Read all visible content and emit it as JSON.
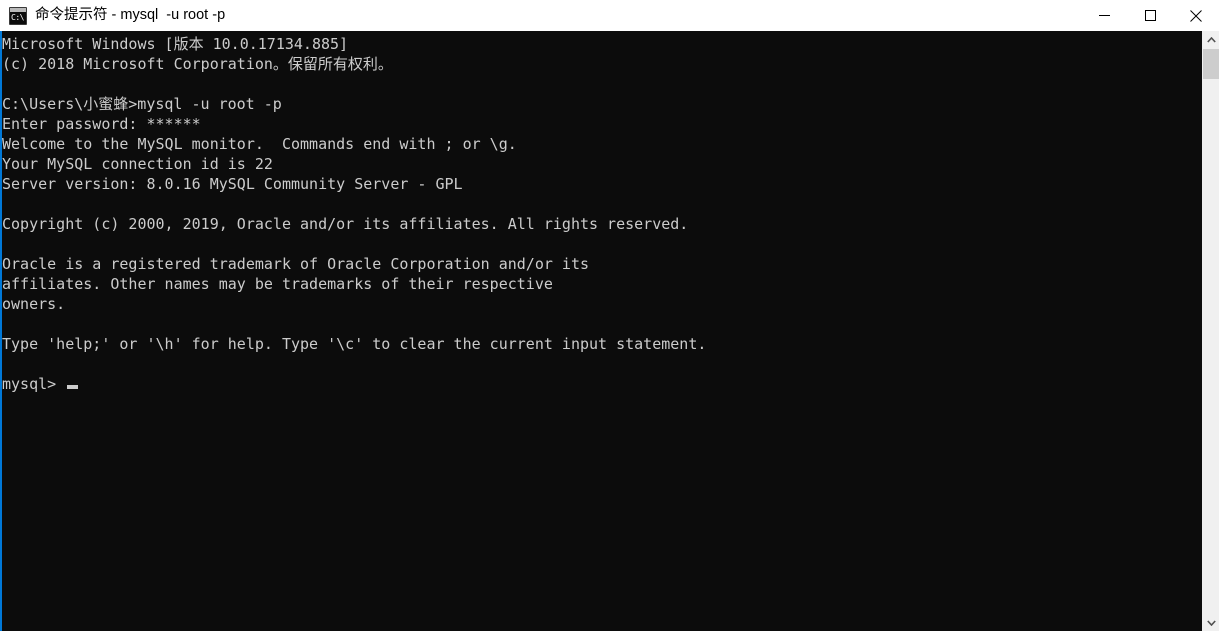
{
  "window": {
    "title": "命令提示符 - mysql  -u root -p",
    "icon_name": "cmd-console-icon",
    "icon_glyph": "C:\\",
    "accent_color": "#0078d7",
    "titlebar_bg": "#ffffff",
    "titlebar_fg": "#000000"
  },
  "controls": {
    "minimize_label": "最小化",
    "maximize_label": "最大化",
    "close_label": "关闭"
  },
  "console": {
    "background": "#0c0c0c",
    "foreground": "#cccccc",
    "font_size_px": 15,
    "line_height_px": 20,
    "lines": [
      "Microsoft Windows [版本 10.0.17134.885]",
      "(c) 2018 Microsoft Corporation。保留所有权利。",
      "",
      "C:\\Users\\小蜜蜂>mysql -u root -p",
      "Enter password: ******",
      "Welcome to the MySQL monitor.  Commands end with ; or \\g.",
      "Your MySQL connection id is 22",
      "Server version: 8.0.16 MySQL Community Server - GPL",
      "",
      "Copyright (c) 2000, 2019, Oracle and/or its affiliates. All rights reserved.",
      "",
      "Oracle is a registered trademark of Oracle Corporation and/or its",
      "affiliates. Other names may be trademarks of their respective",
      "owners.",
      "",
      "Type 'help;' or '\\h' for help. Type '\\c' to clear the current input statement.",
      ""
    ],
    "prompt": "mysql>",
    "cursor": "block-cursor"
  },
  "scrollbar": {
    "up_arrow": "chevron-up-icon",
    "down_arrow": "chevron-down-icon",
    "thumb_name": "scrollbar-thumb",
    "track_color": "#f0f0f0",
    "thumb_color": "#cdcdcd"
  }
}
